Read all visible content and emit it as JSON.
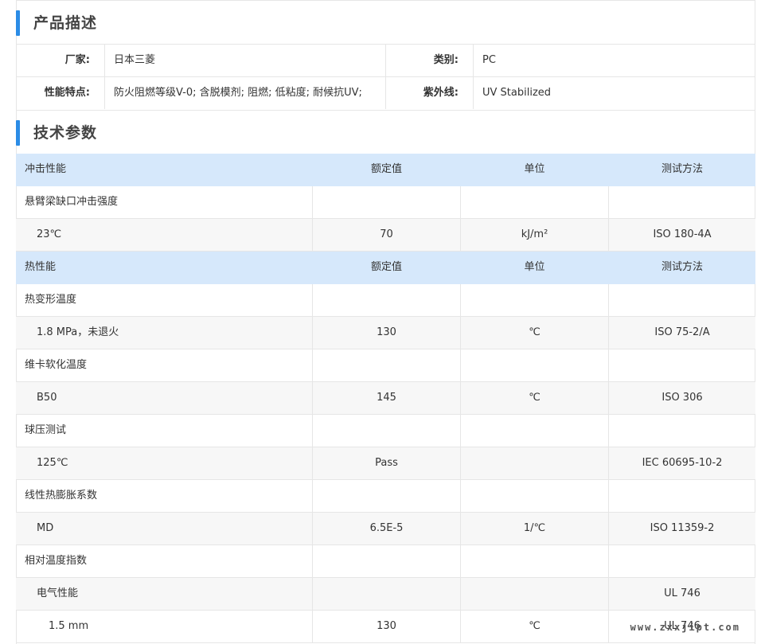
{
  "sections": {
    "description_title": "产品描述",
    "tech_title": "技术参数"
  },
  "description": {
    "rows": [
      {
        "k1": "厂家:",
        "v1": "日本三菱",
        "k2": "类别:",
        "v2": "PC"
      },
      {
        "k1": "性能特点:",
        "v1": "防火阻燃等级V-0; 含脱模剂; 阻燃; 低粘度; 耐候抗UV;",
        "k2": "紫外线:",
        "v2": "UV Stabilized"
      }
    ]
  },
  "tech": {
    "rows": [
      {
        "type": "head",
        "c0": "冲击性能",
        "c1": "额定值",
        "c2": "单位",
        "c3": "测试方法"
      },
      {
        "type": "group",
        "c0": "悬臂梁缺口冲击强度",
        "c1": "",
        "c2": "",
        "c3": ""
      },
      {
        "type": "item",
        "c0": "23℃",
        "c1": "70",
        "c2": "kJ/m²",
        "c3": "ISO 180-4A"
      },
      {
        "type": "head",
        "c0": "热性能",
        "c1": "额定值",
        "c2": "单位",
        "c3": "测试方法"
      },
      {
        "type": "group",
        "c0": "热变形温度",
        "c1": "",
        "c2": "",
        "c3": ""
      },
      {
        "type": "item",
        "c0": "1.8 MPa，未退火",
        "c1": "130",
        "c2": "℃",
        "c3": "ISO 75-2/A"
      },
      {
        "type": "group",
        "c0": "维卡软化温度",
        "c1": "",
        "c2": "",
        "c3": ""
      },
      {
        "type": "item",
        "c0": "B50",
        "c1": "145",
        "c2": "℃",
        "c3": "ISO 306"
      },
      {
        "type": "group",
        "c0": "球压测试",
        "c1": "",
        "c2": "",
        "c3": ""
      },
      {
        "type": "item",
        "c0": "125℃",
        "c1": "Pass",
        "c2": "",
        "c3": "IEC 60695-10-2"
      },
      {
        "type": "group",
        "c0": "线性热膨胀系数",
        "c1": "",
        "c2": "",
        "c3": ""
      },
      {
        "type": "item",
        "c0": "MD",
        "c1": "6.5E-5",
        "c2": "1/℃",
        "c3": "ISO 11359-2"
      },
      {
        "type": "group",
        "c0": "相对温度指数",
        "c1": "",
        "c2": "",
        "c3": ""
      },
      {
        "type": "item",
        "c0": "电气性能",
        "c1": "",
        "c2": "",
        "c3": "UL 746"
      },
      {
        "type": "subitem",
        "c0": "1.5 mm",
        "c1": "130",
        "c2": "℃",
        "c3": "UL 746"
      }
    ]
  },
  "watermark": "www.zxxjipt.com",
  "colors": {
    "accent_bar": "#2b8ce6",
    "header_row_bg": "#d6e8fb",
    "alt_row_bg": "#f7f7f7"
  }
}
